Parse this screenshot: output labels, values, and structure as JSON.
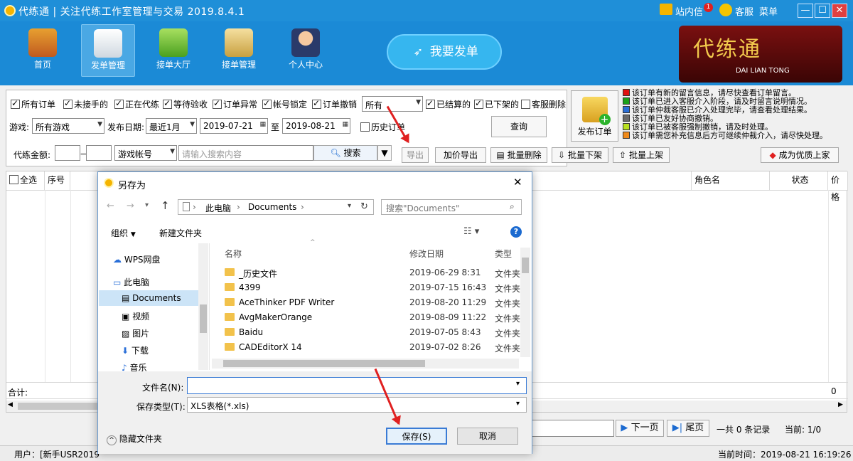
{
  "window": {
    "title": "代练通 | 关注代练工作室管理与交易 2019.8.4.1",
    "mail_label": "站内信",
    "mail_badge": "1",
    "service_label": "客服",
    "menu_label": "菜单",
    "min": "—",
    "max": "☐",
    "close": "✕"
  },
  "nav": [
    {
      "label": "首页",
      "icon": "home-icon"
    },
    {
      "label": "发单管理",
      "icon": "order-manage-icon"
    },
    {
      "label": "接单大厅",
      "icon": "order-hall-icon"
    },
    {
      "label": "接单管理",
      "icon": "clipboard-icon"
    },
    {
      "label": "个人中心",
      "icon": "user-icon"
    }
  ],
  "send_button": "我要发单",
  "logo": {
    "cn": "代练通",
    "en": "DAI LIAN TONG"
  },
  "filters": {
    "checks": [
      {
        "label": "所有订单",
        "checked": true
      },
      {
        "label": "未接手的",
        "checked": true
      },
      {
        "label": "正在代练",
        "checked": true
      },
      {
        "label": "等待验收",
        "checked": true
      },
      {
        "label": "订单异常",
        "checked": true
      },
      {
        "label": "帐号锁定",
        "checked": true
      },
      {
        "label": "订单撤销",
        "checked": true
      }
    ],
    "status_select": "所有",
    "checks2": [
      {
        "label": "已结算的",
        "checked": true
      },
      {
        "label": "已下架的",
        "checked": true
      },
      {
        "label": "客服删除",
        "checked": false
      }
    ],
    "game_label": "游戏:",
    "game_value": "所有游戏",
    "date_label": "发布日期:",
    "date_range": "最近1月",
    "date_from": "2019-07-21",
    "to_label": "至",
    "date_to": "2019-08-21",
    "history_label": "历史订单",
    "query_button": "查询",
    "amount_label": "代练金额:",
    "amount_sep": "—",
    "account_type": "游戏帐号",
    "search_placeholder": "请输入搜索内容",
    "search_button": "搜索"
  },
  "publish_button": "发布订单",
  "legend": [
    {
      "color": "#e01010",
      "text": "该订单有新的留言信息，请尽快查看订单留言。"
    },
    {
      "color": "#1aa01a",
      "text": "该订单已进入客服介入阶段，请及时留言说明情况。"
    },
    {
      "color": "#2a6fd8",
      "text": "该订单仲裁客服已介入处理完毕，请查看处理结果。"
    },
    {
      "color": "#6b6b6b",
      "text": "该订单已友好协商撤销。"
    },
    {
      "color": "#b8e020",
      "text": "该订单已被客服强制撤销，请及时处理。"
    },
    {
      "color": "#f08a1a",
      "text": "该订单需您补充信息后方可继续仲裁介入，请尽快处理。"
    }
  ],
  "actions": {
    "export": "导出",
    "price_export": "加价导出",
    "batch_delete": "批量删除",
    "batch_off": "批量下架",
    "batch_on": "批量上架",
    "premium": "成为优质上家"
  },
  "grid": {
    "select_all": "全选",
    "col_no": "序号",
    "col_role": "角色名",
    "col_status": "状态",
    "col_price": "价格",
    "total_label": "合计:",
    "total_value": "0"
  },
  "pager": {
    "next": "下一页",
    "last": "尾页",
    "summary": "一共 0 条记录",
    "current": "当前: 1/0"
  },
  "status": {
    "user": "用户：[新手USR2019",
    "time": "当前时间：2019-08-21 16:19:26"
  },
  "dialog": {
    "title": "另存为",
    "breadcrumb": [
      "此电脑",
      "Documents"
    ],
    "search_placeholder": "搜索\"Documents\"",
    "organize": "组织",
    "new_folder": "新建文件夹",
    "tree": [
      "WPS网盘",
      "此电脑",
      "Documents",
      "视频",
      "图片",
      "下载",
      "音乐"
    ],
    "col_name": "名称",
    "col_date": "修改日期",
    "col_type": "类型",
    "files": [
      {
        "name": "_历史文件",
        "date": "2019-06-29 8:31",
        "type": "文件夹"
      },
      {
        "name": "4399",
        "date": "2019-07-15 16:43",
        "type": "文件夹"
      },
      {
        "name": "AceThinker PDF Writer",
        "date": "2019-08-20 11:29",
        "type": "文件夹"
      },
      {
        "name": "AvgMakerOrange",
        "date": "2019-08-09 11:22",
        "type": "文件夹"
      },
      {
        "name": "Baidu",
        "date": "2019-07-05 8:43",
        "type": "文件夹"
      },
      {
        "name": "CADEditorX 14",
        "date": "2019-07-02 8:26",
        "type": "文件夹"
      }
    ],
    "filename_label": "文件名(N):",
    "filename_value": "",
    "filetype_label": "保存类型(T):",
    "filetype_value": "XLS表格(*.xls)",
    "hide_folders": "隐藏文件夹",
    "save": "保存(S)",
    "cancel": "取消"
  }
}
